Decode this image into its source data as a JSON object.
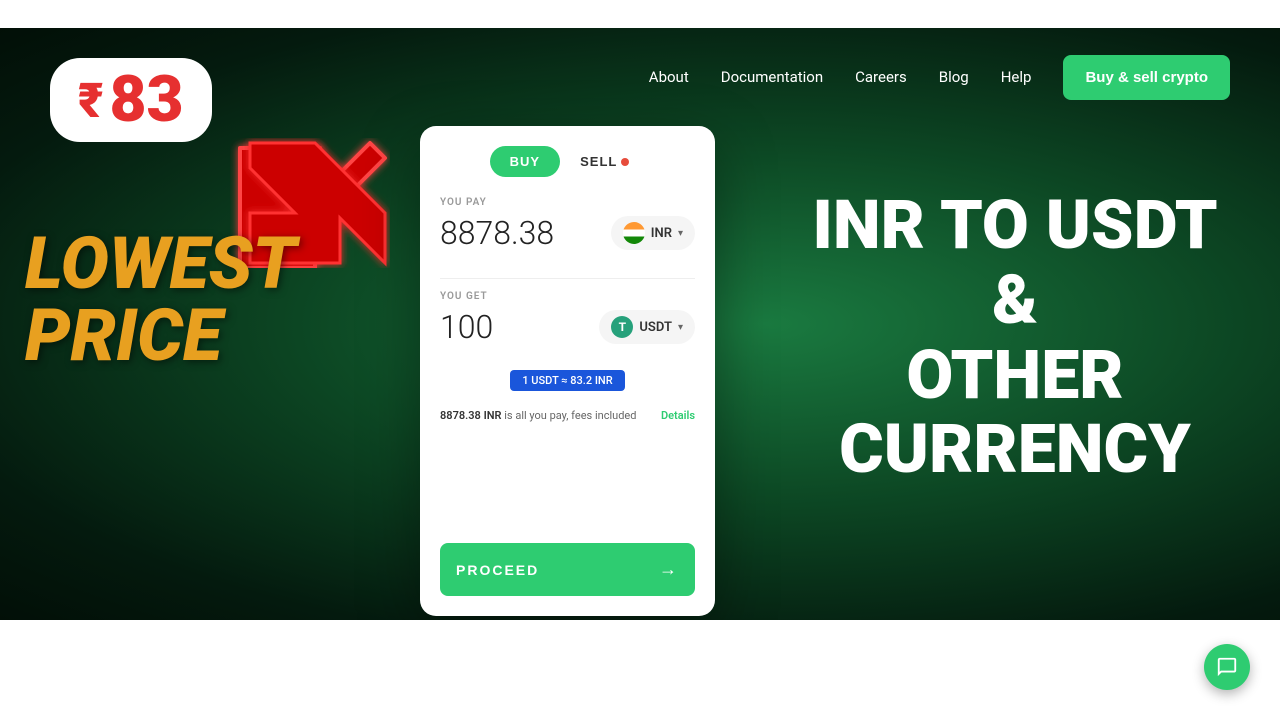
{
  "navbar": {
    "height": 28
  },
  "nav": {
    "links": [
      {
        "id": "about",
        "label": "About"
      },
      {
        "id": "documentation",
        "label": "Documentation"
      },
      {
        "id": "careers",
        "label": "Careers"
      },
      {
        "id": "blog",
        "label": "Blog"
      },
      {
        "id": "help",
        "label": "Help"
      }
    ],
    "cta_label": "Buy & sell crypto"
  },
  "hero": {
    "price_badge": {
      "symbol": "₹",
      "number": "83"
    },
    "lowest_price": {
      "line1": "LOWEST",
      "line2": "PRICE"
    },
    "exchange_card": {
      "tab_buy": "BUY",
      "tab_sell": "SELL",
      "you_pay_label": "YOU PAY",
      "you_pay_value": "8878.38",
      "inr_currency": "INR",
      "you_get_label": "YOU GET",
      "you_get_value": "100",
      "usdt_currency": "USDT",
      "rate_badge": "1 USDT ≈ 83.2 INR",
      "fee_amount": "8878.38",
      "fee_currency": "INR",
      "fee_text": "is all you pay, fees included",
      "details_link": "Details",
      "proceed_label": "PROCEED",
      "proceed_arrow": "→"
    },
    "right_title_line1": "INR TO USDT",
    "right_title_line2": "&",
    "right_title_line3": "OTHER",
    "right_title_line4": "CURRENCY"
  },
  "chat": {
    "icon_label": "chat-icon"
  }
}
